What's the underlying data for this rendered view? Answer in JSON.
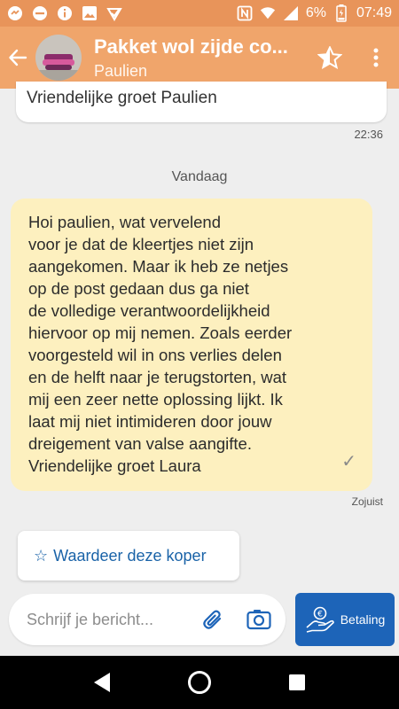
{
  "status_bar": {
    "battery": "6%",
    "time": "07:49"
  },
  "header": {
    "title": "Pakket wol zijde co...",
    "subtitle": "Paulien"
  },
  "messages": {
    "previous": {
      "text": "Vriendelijke groet Paulien",
      "time": "22:36"
    },
    "day_separator": "Vandaag",
    "mine": {
      "lines": [
        "Hoi paulien, wat vervelend",
        "voor je dat de kleertjes niet zijn",
        "aangekomen. Maar ik heb ze netjes",
        "op de post gedaan dus ga niet",
        "de volledige verantwoordelijkheid",
        "hiervoor op mij nemen. Zoals eerder",
        "voorgesteld wil in ons verlies delen",
        "en de helft naar je terugstorten, wat",
        "mij een zeer nette oplossing lijkt. Ik",
        "laat mij niet intimideren door jouw",
        "dreigement van valse aangifte.",
        "Vriendelijke groet Laura"
      ],
      "status_glyph": "✓",
      "time": "Zojuist"
    }
  },
  "rate_button": {
    "icon": "☆",
    "label": "Waardeer deze koper"
  },
  "composer": {
    "placeholder": "Schrijf je bericht..."
  },
  "payment_button": {
    "label": "Betaling"
  },
  "colors": {
    "header_bg": "#f0a56b",
    "status_bg": "#e8945a",
    "my_bubble": "#fdf0bf",
    "accent_blue": "#1d64b8"
  }
}
